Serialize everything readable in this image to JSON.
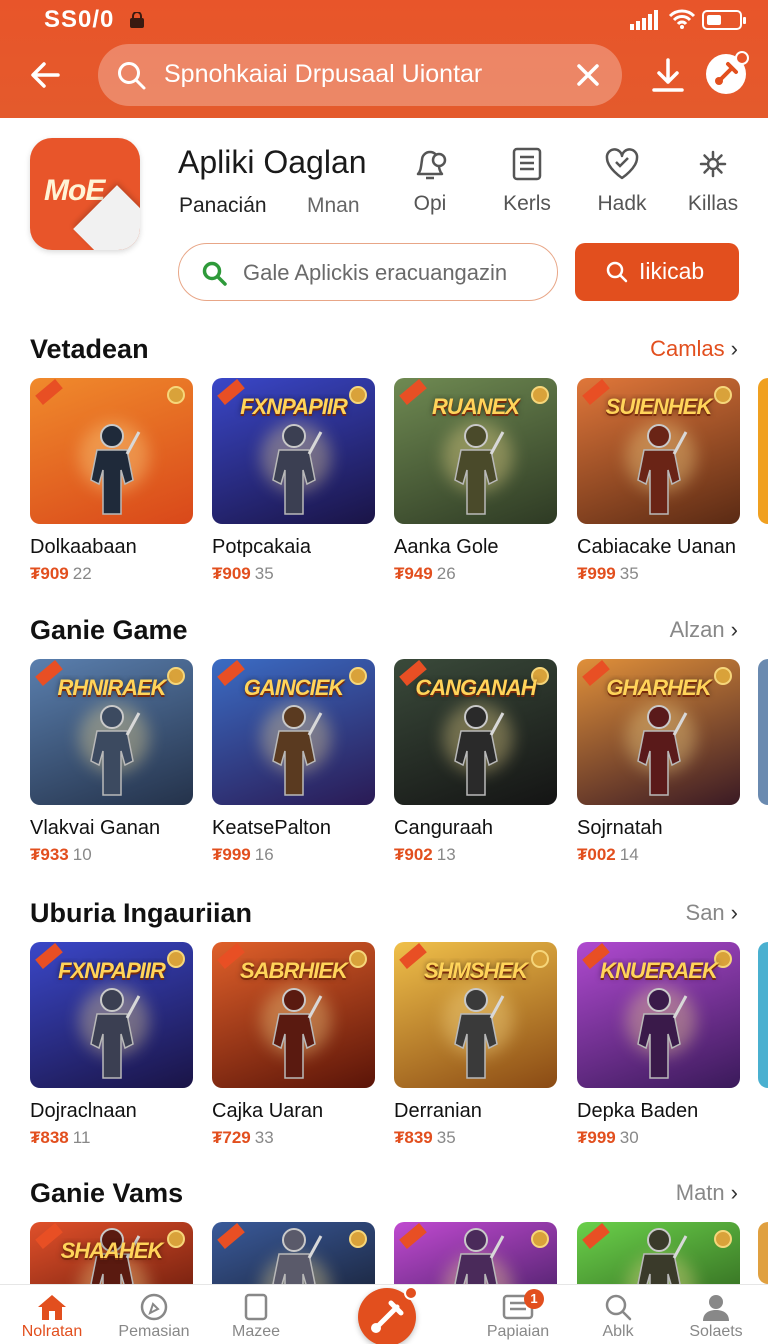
{
  "status_bar": {
    "time": "SS0/0"
  },
  "search": {
    "query": "Spnohkaiai Drpusaal Uiontar"
  },
  "app": {
    "name": "Apliki Oaglan",
    "subtitle_primary": "Panacián",
    "subtitle_secondary": "Mnan",
    "logo_text": "MoE",
    "quick_actions": [
      {
        "label": "Opi",
        "icon": "bell-icon"
      },
      {
        "label": "Kerls",
        "icon": "list-icon"
      },
      {
        "label": "Hadk",
        "icon": "heart-icon"
      },
      {
        "label": "Killas",
        "icon": "gear-icon"
      }
    ],
    "inner_search_placeholder": "Gale Aplickis eracuangazin",
    "action_button_label": "Iikicab"
  },
  "sections": [
    {
      "title": "Vetadean",
      "more_label": "Camlas",
      "more_accent": true,
      "items": [
        {
          "name": "Dolkaabaan",
          "price": "₮909",
          "rating": "22",
          "logo": "",
          "bg": [
            "#f08a2c",
            "#d9481a"
          ],
          "hero": "#1f2a3a"
        },
        {
          "name": "Potpcakaia",
          "price": "₮909",
          "rating": "35",
          "logo": "FXNPAPIIR",
          "bg": [
            "#3a47c8",
            "#1a1446"
          ],
          "hero": "#3b3f52"
        },
        {
          "name": "Aanka Gole",
          "price": "₮949",
          "rating": "26",
          "logo": "RUANEX",
          "bg": [
            "#6f8a52",
            "#2e3a24"
          ],
          "hero": "#4a4a2a"
        },
        {
          "name": "Cabiacake Uanan",
          "price": "₮999",
          "rating": "35",
          "logo": "SUIENHEK",
          "bg": [
            "#e0773a",
            "#5a2a14"
          ],
          "hero": "#6a2416"
        }
      ],
      "peek_color": "#f0a020"
    },
    {
      "title": "Ganie Game",
      "more_label": "Alzan",
      "more_accent": false,
      "items": [
        {
          "name": "Vlakvai Ganan",
          "price": "₮933",
          "rating": "10",
          "logo": "RHNIRAEK",
          "bg": [
            "#5a7fae",
            "#24324a"
          ],
          "hero": "#3c4a60"
        },
        {
          "name": "KeatsePalton",
          "price": "₮999",
          "rating": "16",
          "logo": "GAINCIEK",
          "bg": [
            "#3b6cc4",
            "#2a1a54"
          ],
          "hero": "#5a3a20"
        },
        {
          "name": "Canguraah",
          "price": "₮902",
          "rating": "13",
          "logo": "CANGANAH",
          "bg": [
            "#3a4a3a",
            "#141414"
          ],
          "hero": "#2a2a2a"
        },
        {
          "name": "Sojrnatah",
          "price": "₮002",
          "rating": "14",
          "logo": "GHARHEK",
          "bg": [
            "#e0903a",
            "#3a1a24"
          ],
          "hero": "#5a1a1a"
        }
      ],
      "peek_color": "#6a8ab0"
    },
    {
      "title": "Uburia Ingauriian",
      "more_label": "San",
      "more_accent": false,
      "items": [
        {
          "name": "Dojraclnaan",
          "price": "₮838",
          "rating": "11",
          "logo": "FXNPAPIIR",
          "bg": [
            "#3a47c8",
            "#1a1446"
          ],
          "hero": "#3b3f52"
        },
        {
          "name": "Cajka Uaran",
          "price": "₮729",
          "rating": "33",
          "logo": "SABRHIEK",
          "bg": [
            "#e0602a",
            "#5a1408"
          ],
          "hero": "#5a1a10"
        },
        {
          "name": "Derranian",
          "price": "₮839",
          "rating": "35",
          "logo": "SHMSHEK",
          "bg": [
            "#f0c04a",
            "#8a4a14"
          ],
          "hero": "#3a3a3a"
        },
        {
          "name": "Depka Baden",
          "price": "₮999",
          "rating": "30",
          "logo": "KNUERAEK",
          "bg": [
            "#b04ad0",
            "#3a1a5a"
          ],
          "hero": "#3a1a4a"
        }
      ],
      "peek_color": "#4ab0d0"
    },
    {
      "title": "Ganie Vams",
      "more_label": "Matn",
      "more_accent": false,
      "items": [
        {
          "name": "",
          "price": "",
          "rating": "",
          "logo": "SHAAHEK",
          "bg": [
            "#e0502a",
            "#5a1408"
          ],
          "hero": "#5a1a10"
        },
        {
          "name": "",
          "price": "",
          "rating": "",
          "logo": "",
          "bg": [
            "#3a5a9a",
            "#141a2a"
          ],
          "hero": "#5a5a6a"
        },
        {
          "name": "",
          "price": "",
          "rating": "",
          "logo": "",
          "bg": [
            "#c04ad0",
            "#3a1a5a"
          ],
          "hero": "#4a2a5a"
        },
        {
          "name": "",
          "price": "",
          "rating": "",
          "logo": "",
          "bg": [
            "#6ad04a",
            "#2a5a1a"
          ],
          "hero": "#3a3a2a"
        }
      ],
      "peek_color": "#e0a040"
    }
  ],
  "bottom_nav": [
    {
      "label": "Nolratan",
      "icon": "home-icon",
      "active": true
    },
    {
      "label": "Pemasian",
      "icon": "compass-icon",
      "active": false
    },
    {
      "label": "Mazee",
      "icon": "tablet-icon",
      "active": false
    },
    {
      "label": "Papiaian",
      "icon": "inbox-icon",
      "active": false,
      "badge": "1"
    },
    {
      "label": "Ablk",
      "icon": "search-icon",
      "active": false
    },
    {
      "label": "Solaets",
      "icon": "profile-icon",
      "active": false
    }
  ],
  "colors": {
    "brand": "#e24f1e",
    "header": "#e8552a",
    "price": "#e24f1e"
  }
}
